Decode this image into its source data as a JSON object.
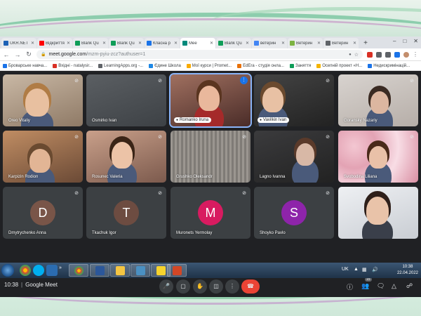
{
  "browser": {
    "tabs": [
      {
        "label": "UKR.NET",
        "color": "#1d61b5",
        "active": false
      },
      {
        "label": "Відкриття",
        "color": "#ff0000",
        "active": false
      },
      {
        "label": "Blank Qu",
        "color": "#0f9d58",
        "active": false
      },
      {
        "label": "Blank Qu",
        "color": "#0f9d58",
        "active": false
      },
      {
        "label": "Класна р",
        "color": "#1a73e8",
        "active": false
      },
      {
        "label": "Mee",
        "color": "#00897b",
        "active": true
      },
      {
        "label": "Blank Qu",
        "color": "#0f9d58",
        "active": false
      },
      {
        "label": "ветерин",
        "color": "#4285f4",
        "active": false
      },
      {
        "label": "Ветерин",
        "color": "#7cb342",
        "active": false
      },
      {
        "label": "Ветерин",
        "color": "#5f6368",
        "active": false
      }
    ],
    "new_tab": "+",
    "url_host": "meet.google.com",
    "url_path": "/mzm-pyiu-zcz?authuser=1",
    "bookmarks": [
      {
        "label": "Броварське навча...",
        "color": "#1a73e8"
      },
      {
        "label": "Вхідні - natalysir...",
        "color": "#d93025"
      },
      {
        "label": "LearningApps.org -...",
        "color": "#5f6368"
      },
      {
        "label": "Єдине Школа",
        "color": "#1e88e5"
      },
      {
        "label": "Мої курси | Promet...",
        "color": "#f9ab00"
      },
      {
        "label": "EdEra - студія онла...",
        "color": "#e8710a"
      },
      {
        "label": "Заняття",
        "color": "#0f9d58"
      },
      {
        "label": "Осепній проект «Н...",
        "color": "#f4b400"
      },
      {
        "label": "Недискримінацій...",
        "color": "#1a73e8"
      }
    ]
  },
  "participants": [
    {
      "name": "Oreo Vitaliy",
      "mic": "muted"
    },
    {
      "name": "Osmirko Ivan",
      "mic": "muted"
    },
    {
      "name": "Romanko Iruna",
      "mic": "speaking"
    },
    {
      "name": "Vavilkin Ivan",
      "mic": "muted"
    },
    {
      "name": "Goransky Nazariy",
      "mic": "muted"
    },
    {
      "name": "Karpizin Rodion",
      "mic": "muted"
    },
    {
      "name": "Rosunec Valeria",
      "mic": "muted"
    },
    {
      "name": "Grushko Oleksandr",
      "mic": "muted"
    },
    {
      "name": "Lagno Ivanna",
      "mic": "muted"
    },
    {
      "name": "Svobodina Liliana",
      "mic": "muted"
    },
    {
      "name": "Dmytrychenko Anna",
      "mic": "muted",
      "initial": "D",
      "color": "#795548"
    },
    {
      "name": "Tkachuk Igor",
      "mic": "muted",
      "initial": "T",
      "color": "#6d4c41"
    },
    {
      "name": "Muronets Yermolay",
      "mic": "muted",
      "initial": "M",
      "color": "#d81b60"
    },
    {
      "name": "Shoyko Pavlo",
      "mic": "muted",
      "initial": "S",
      "color": "#8e24aa"
    },
    {
      "name": "",
      "mic": "none"
    }
  ],
  "meetbar": {
    "time": "10:38",
    "app": "Google Meet",
    "participants_count": "15"
  },
  "taskbar": {
    "lang": "UK",
    "time": "10:38",
    "date": "22.04.2022"
  }
}
